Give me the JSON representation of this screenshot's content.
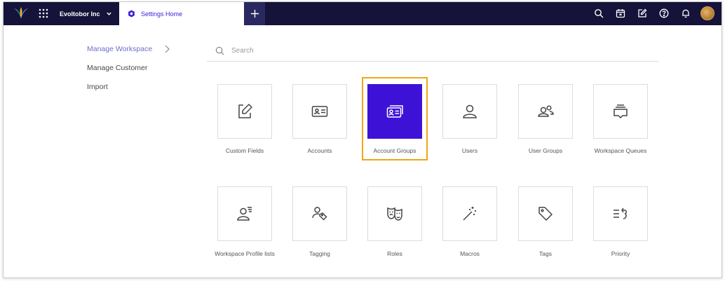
{
  "topbar": {
    "org_name": "Evoltobor Inc",
    "tab_label": "Settings Home",
    "icons": [
      "search-icon",
      "calendar-icon",
      "compose-icon",
      "help-icon",
      "bell-icon"
    ]
  },
  "sidebar": {
    "items": [
      {
        "label": "Manage Workspace",
        "active": true
      },
      {
        "label": "Manage Customer",
        "active": false
      },
      {
        "label": "Import",
        "active": false
      }
    ]
  },
  "search": {
    "placeholder": "Search"
  },
  "tiles": [
    {
      "label": "Custom Fields",
      "icon": "edit-field-icon"
    },
    {
      "label": "Accounts",
      "icon": "account-card-icon"
    },
    {
      "label": "Account Groups",
      "icon": "account-group-icon",
      "selected": true
    },
    {
      "label": "Users",
      "icon": "user-icon"
    },
    {
      "label": "User Groups",
      "icon": "user-group-icon"
    },
    {
      "label": "Workspace Queues",
      "icon": "queue-icon"
    },
    {
      "label": "Workspace Profile lists",
      "icon": "profile-list-icon"
    },
    {
      "label": "Tagging",
      "icon": "tagging-icon"
    },
    {
      "label": "Roles",
      "icon": "masks-icon"
    },
    {
      "label": "Macros",
      "icon": "magic-wand-icon"
    },
    {
      "label": "Tags",
      "icon": "tag-icon"
    },
    {
      "label": "Priority",
      "icon": "priority-icon"
    }
  ],
  "colors": {
    "topbar": "#15133a",
    "accent": "#3d12d6",
    "highlight": "#f0a516"
  }
}
